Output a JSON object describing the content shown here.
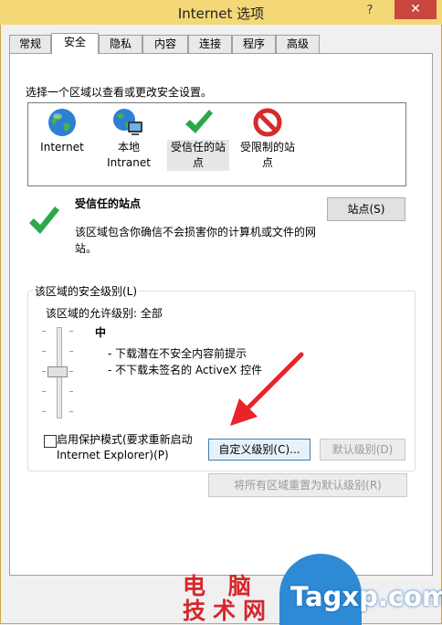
{
  "window": {
    "title": "Internet 选项",
    "help_label": "?",
    "close_label": "✕"
  },
  "tabs": [
    {
      "label": "常规"
    },
    {
      "label": "安全"
    },
    {
      "label": "隐私"
    },
    {
      "label": "内容"
    },
    {
      "label": "连接"
    },
    {
      "label": "程序"
    },
    {
      "label": "高级"
    }
  ],
  "active_tab": "安全",
  "zones": {
    "instruction": "选择一个区域以查看或更改安全设置。",
    "items": [
      {
        "line1": "Internet",
        "line2": "",
        "icon": "globe-icon"
      },
      {
        "line1": "本地",
        "line2": "Intranet",
        "icon": "local-intranet-icon"
      },
      {
        "line1": "受信任的站",
        "line2": "点",
        "icon": "checkmark-icon"
      },
      {
        "line1": "受限制的站",
        "line2": "点",
        "icon": "restricted-icon"
      }
    ],
    "selected": "受信任的站点"
  },
  "detail": {
    "title": "受信任的站点",
    "desc": "该区域包含你确信不会损害你的计算机或文件的网站。",
    "sites_button": "站点(S)"
  },
  "security_level": {
    "group_label": "该区域的安全级别(L)",
    "allowed": "该区域的允许级别: 全部",
    "level": "中",
    "items": [
      "- 下载潜在不安全内容前提示",
      "- 不下载未签名的 ActiveX 控件"
    ],
    "slider_level": "中"
  },
  "protected_mode": {
    "checked": false,
    "line1": "启用保护模式(要求重新启动",
    "line2": "Internet Explorer)(P)"
  },
  "buttons": {
    "custom_level": "自定义级别(C)...",
    "default_level": "默认级别(D)",
    "reset_all": "将所有区域重置为默认级别(R)"
  },
  "watermark": {
    "cn_line1": "电 脑",
    "cn_line2": "技术网",
    "en": "Tagxp.com"
  },
  "colors": {
    "titlebar": "#f4d777",
    "close": "#c7463f",
    "arrow": "#e8232a",
    "check": "#2ba84a",
    "restricted": "#d42b2b"
  }
}
